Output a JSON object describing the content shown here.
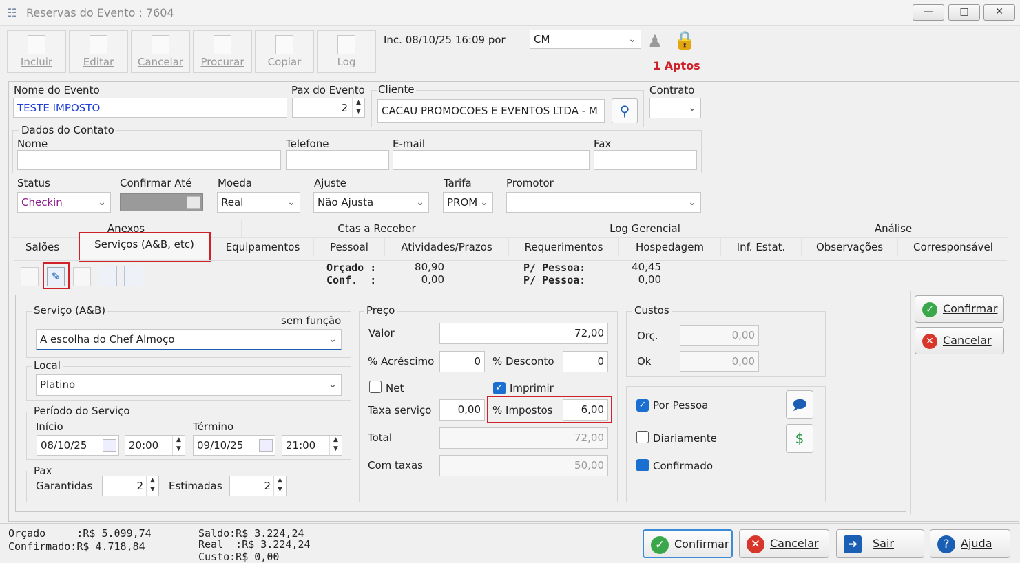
{
  "window": {
    "title": "Reservas do Evento : 7604"
  },
  "toolbar": {
    "buttons": [
      "Incluir",
      "Editar",
      "Cancelar",
      "Procurar",
      "Copiar",
      "Log"
    ],
    "inc_info": "Inc. 08/10/25 16:09 por",
    "user_select": "CM",
    "aptos": "1 Aptos"
  },
  "evento": {
    "nome_label": "Nome do Evento",
    "nome_value": "TESTE IMPOSTO",
    "pax_label": "Pax do Evento",
    "pax_value": "2",
    "cliente_label": "Cliente",
    "cliente_value": "CACAU PROMOCOES E EVENTOS LTDA - M",
    "contrato_label": "Contrato",
    "contrato_value": ""
  },
  "contato": {
    "title": "Dados do Contato",
    "nome_label": "Nome",
    "telefone_label": "Telefone",
    "email_label": "E-mail",
    "fax_label": "Fax"
  },
  "row3": {
    "status_label": "Status",
    "status_value": "Checkin",
    "confirmar_label": "Confirmar Até",
    "moeda_label": "Moeda",
    "moeda_value": "Real",
    "ajuste_label": "Ajuste",
    "ajuste_value": "Não Ajusta",
    "tarifa_label": "Tarifa",
    "tarifa_value": "PROM",
    "promotor_label": "Promotor",
    "promotor_value": ""
  },
  "tabs_top": [
    "Anexos",
    "Ctas a Receber",
    "Log Gerencial",
    "Análise"
  ],
  "tabs_bottom": [
    "Salões",
    "Serviços (A&B, etc)",
    "Equipamentos",
    "Pessoal",
    "Atividades/Prazos",
    "Requerimentos",
    "Hospedagem",
    "Inf. Estat.",
    "Observações",
    "Corresponsável"
  ],
  "summary": {
    "orcado_label": "Orçado :",
    "orcado_value": "80,90",
    "conf_label": "Conf.  :",
    "conf_value": "0,00",
    "pp_label1": "P/ Pessoa:",
    "pp_value1": "40,45",
    "pp_label2": "P/ Pessoa:",
    "pp_value2": "0,00"
  },
  "servico": {
    "title": "Serviço (A&B)",
    "sem_funcao": "sem função",
    "value": "A escolha do Chef Almoço",
    "local_label": "Local",
    "local_value": "Platino",
    "periodo_label": "Período do Serviço",
    "inicio_label": "Início",
    "inicio_date": "08/10/25",
    "inicio_time": "20:00",
    "termino_label": "Término",
    "termino_date": "09/10/25",
    "termino_time": "21:00",
    "pax_label": "Pax",
    "garantidas_label": "Garantidas",
    "garantidas_value": "2",
    "estimadas_label": "Estimadas",
    "estimadas_value": "2"
  },
  "preco": {
    "title": "Preço",
    "valor_label": "Valor",
    "valor_value": "72,00",
    "acrescimo_label": "% Acréscimo",
    "acrescimo_value": "0",
    "desconto_label": "% Desconto",
    "desconto_value": "0",
    "net_label": "Net",
    "imprimir_label": "Imprimir",
    "taxa_label": "Taxa serviço",
    "taxa_value": "0,00",
    "impostos_label": "% Impostos",
    "impostos_value": "6,00",
    "total_label": "Total",
    "total_value": "72,00",
    "comtaxas_label": "Com taxas",
    "comtaxas_value": "50,00"
  },
  "custos": {
    "title": "Custos",
    "orc_label": "Orç.",
    "orc_value": "0,00",
    "ok_label": "Ok",
    "ok_value": "0,00"
  },
  "flags": {
    "por_pessoa": "Por Pessoa",
    "diariamente": "Diariamente",
    "confirmado": "Confirmado"
  },
  "side_buttons": {
    "confirmar": "Confirmar",
    "cancelar": "Cancelar"
  },
  "footer": {
    "line1": "Orçado     :R$ 5.099,74",
    "line2": "Confirmado:R$ 4.718,84",
    "line3": "Saldo:R$ 3.224,24",
    "line4": "Real  :R$ 3.224,24",
    "line5": "Custo:R$ 0,00",
    "confirmar": "Confirmar",
    "cancelar": "Cancelar",
    "sair": "Sair",
    "ajuda": "Ajuda"
  },
  "colors": {
    "accent_red": "#d0202a",
    "blue_text": "#1f3fd6",
    "status_purple": "#8b1f8b",
    "check_blue": "#1a6fd0"
  }
}
